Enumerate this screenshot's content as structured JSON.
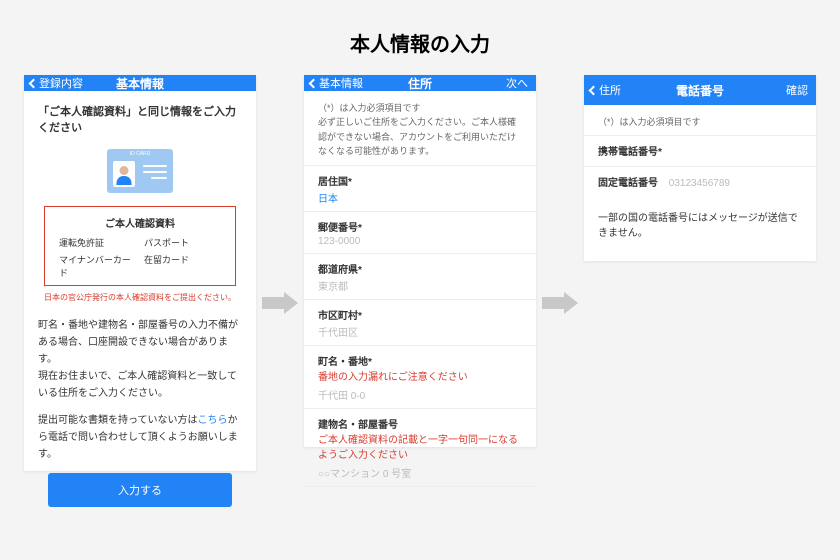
{
  "page_title": "本人情報の入力",
  "phone1": {
    "nav_back": "登録内容",
    "nav_title": "基本情報",
    "instruction": "「ご本人確認資料」と同じ情報をご入力ください",
    "docbox_title": "ご本人確認資料",
    "docs": [
      "運転免許証",
      "パスポート",
      "マイナンバーカード",
      "在留カード"
    ],
    "govnote": "日本の官公庁発行の本人確認資料をご提出ください。",
    "para1": "町名・番地や建物名・部屋番号の入力不備がある場合、口座開設できない場合があります。\n現在お住まいで、ご本人確認資料と一致している住所をご入力ください。",
    "para2_a": "提出可能な書類を持っていない方は",
    "para2_link": "こちら",
    "para2_b": "から電話で問い合わせして頂くようお願いします。",
    "button": "入力する"
  },
  "phone2": {
    "nav_back": "基本情報",
    "nav_title": "住所",
    "nav_next": "次へ",
    "reqnote": "（*）は入力必須項目です\n必ず正しいご住所をご入力ください。ご本人様確認ができない場合、アカウントをご利用いただけなくなる可能性があります。",
    "f_country_label": "居住国*",
    "f_country_val": "日本",
    "f_zip_label": "郵便番号*",
    "f_zip_ph": "123-0000",
    "f_pref_label": "都道府県*",
    "f_pref_ph": "東京都",
    "f_city_label": "市区町村*",
    "f_city_ph": "千代田区",
    "f_street_label": "町名・番地*",
    "f_street_warn": "番地の入力漏れにご注意ください",
    "f_street_ph": "千代田 0-0",
    "f_bldg_label": "建物名・部屋番号",
    "f_bldg_warn": "ご本人確認資料の記載と一字一句同一になるようご入力ください",
    "f_bldg_ph": "○○マンション 0 号室"
  },
  "phone3": {
    "nav_back": "住所",
    "nav_title": "電話番号",
    "nav_next": "確認",
    "reqnote": "（*）は入力必須項目です",
    "f_mobile_label": "携帯電話番号*",
    "f_landline_label": "固定電話番号",
    "f_landline_ph": "03123456789",
    "footnote": "一部の国の電話番号にはメッセージが送信できません。"
  }
}
